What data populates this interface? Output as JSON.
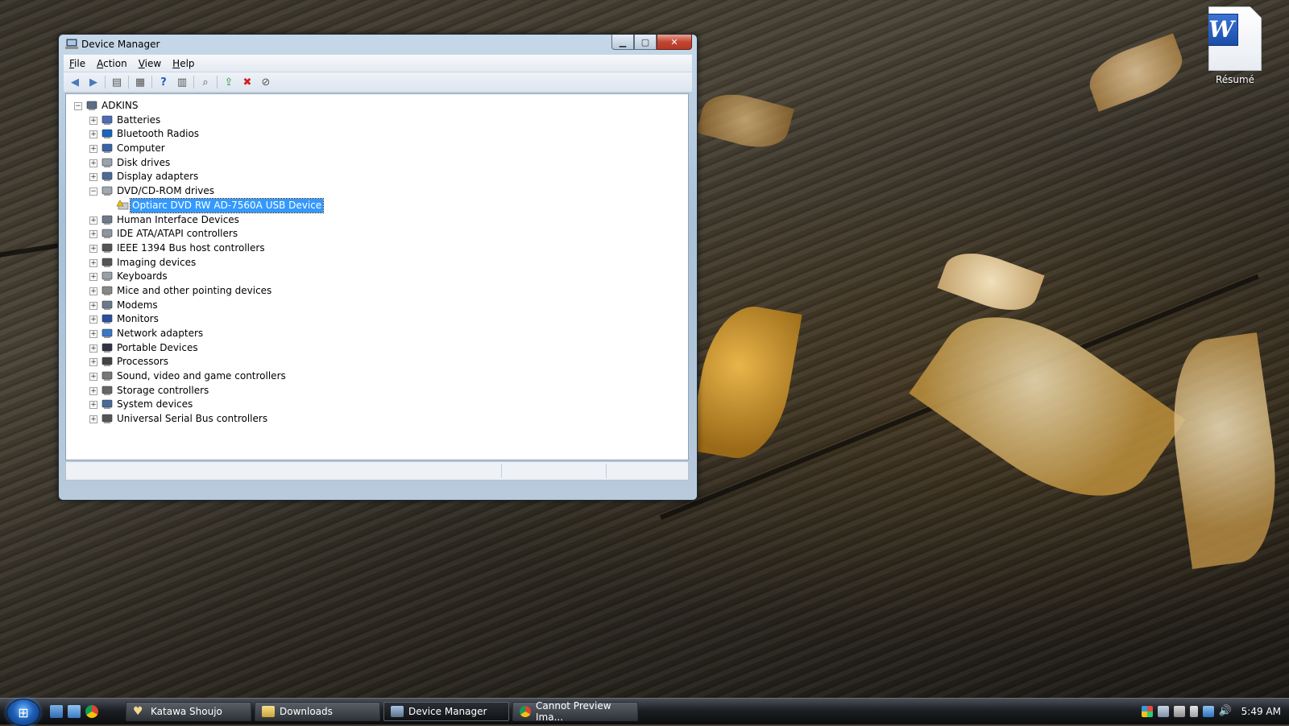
{
  "desktop": {
    "icons": [
      {
        "label": "Résumé",
        "icon": "word-document-icon"
      }
    ]
  },
  "window": {
    "title": "Device Manager",
    "menu": [
      "File",
      "Action",
      "View",
      "Help"
    ],
    "menu_accel": [
      "F",
      "A",
      "V",
      "H"
    ],
    "toolbar_icons": [
      "back-arrow-icon",
      "forward-arrow-icon",
      "show-hide-console-tree-icon",
      "properties-icon",
      "help-icon",
      "view-icon",
      "scan-hardware-icon",
      "update-driver-icon",
      "uninstall-icon",
      "disable-device-icon"
    ],
    "tree": {
      "root": "ADKINS",
      "categories": [
        {
          "label": "Batteries",
          "expanded": false,
          "icon": "battery-icon"
        },
        {
          "label": "Bluetooth Radios",
          "expanded": false,
          "icon": "bluetooth-icon"
        },
        {
          "label": "Computer",
          "expanded": false,
          "icon": "computer-icon"
        },
        {
          "label": "Disk drives",
          "expanded": false,
          "icon": "disk-drive-icon"
        },
        {
          "label": "Display adapters",
          "expanded": false,
          "icon": "display-adapter-icon"
        },
        {
          "label": "DVD/CD-ROM drives",
          "expanded": true,
          "icon": "dvd-drive-icon",
          "children": [
            {
              "label": "Optiarc DVD RW AD-7560A USB Device",
              "selected": true,
              "icon": "dvd-device-warning-icon"
            }
          ]
        },
        {
          "label": "Human Interface Devices",
          "expanded": false,
          "icon": "hid-icon"
        },
        {
          "label": "IDE ATA/ATAPI controllers",
          "expanded": false,
          "icon": "ide-controller-icon"
        },
        {
          "label": "IEEE 1394 Bus host controllers",
          "expanded": false,
          "icon": "firewire-icon"
        },
        {
          "label": "Imaging devices",
          "expanded": false,
          "icon": "camera-icon"
        },
        {
          "label": "Keyboards",
          "expanded": false,
          "icon": "keyboard-icon"
        },
        {
          "label": "Mice and other pointing devices",
          "expanded": false,
          "icon": "mouse-icon"
        },
        {
          "label": "Modems",
          "expanded": false,
          "icon": "modem-icon"
        },
        {
          "label": "Monitors",
          "expanded": false,
          "icon": "monitor-icon"
        },
        {
          "label": "Network adapters",
          "expanded": false,
          "icon": "network-adapter-icon"
        },
        {
          "label": "Portable Devices",
          "expanded": false,
          "icon": "portable-device-icon"
        },
        {
          "label": "Processors",
          "expanded": false,
          "icon": "processor-icon"
        },
        {
          "label": "Sound, video and game controllers",
          "expanded": false,
          "icon": "speaker-icon"
        },
        {
          "label": "Storage controllers",
          "expanded": false,
          "icon": "storage-controller-icon"
        },
        {
          "label": "System devices",
          "expanded": false,
          "icon": "system-device-icon"
        },
        {
          "label": "Universal Serial Bus controllers",
          "expanded": false,
          "icon": "usb-icon"
        }
      ]
    }
  },
  "taskbar": {
    "quick_launch": [
      "show-desktop-icon",
      "switch-windows-icon",
      "chrome-icon"
    ],
    "buttons": [
      {
        "label": "Katawa Shoujo",
        "icon": "heart-icon",
        "active": false
      },
      {
        "label": "Downloads",
        "icon": "folder-icon",
        "active": false
      },
      {
        "label": "Device Manager",
        "icon": "device-manager-icon",
        "active": true
      },
      {
        "label": "Cannot Preview Ima...",
        "icon": "chrome-icon",
        "active": false
      }
    ],
    "tray_icons": [
      "windows-flag-icon",
      "network-icon",
      "display-icon",
      "power-icon",
      "network-status-icon",
      "volume-icon"
    ],
    "clock": "5:49 AM"
  },
  "colors": {
    "selection": "#3399ff",
    "taskbar": "#1c1f24"
  }
}
